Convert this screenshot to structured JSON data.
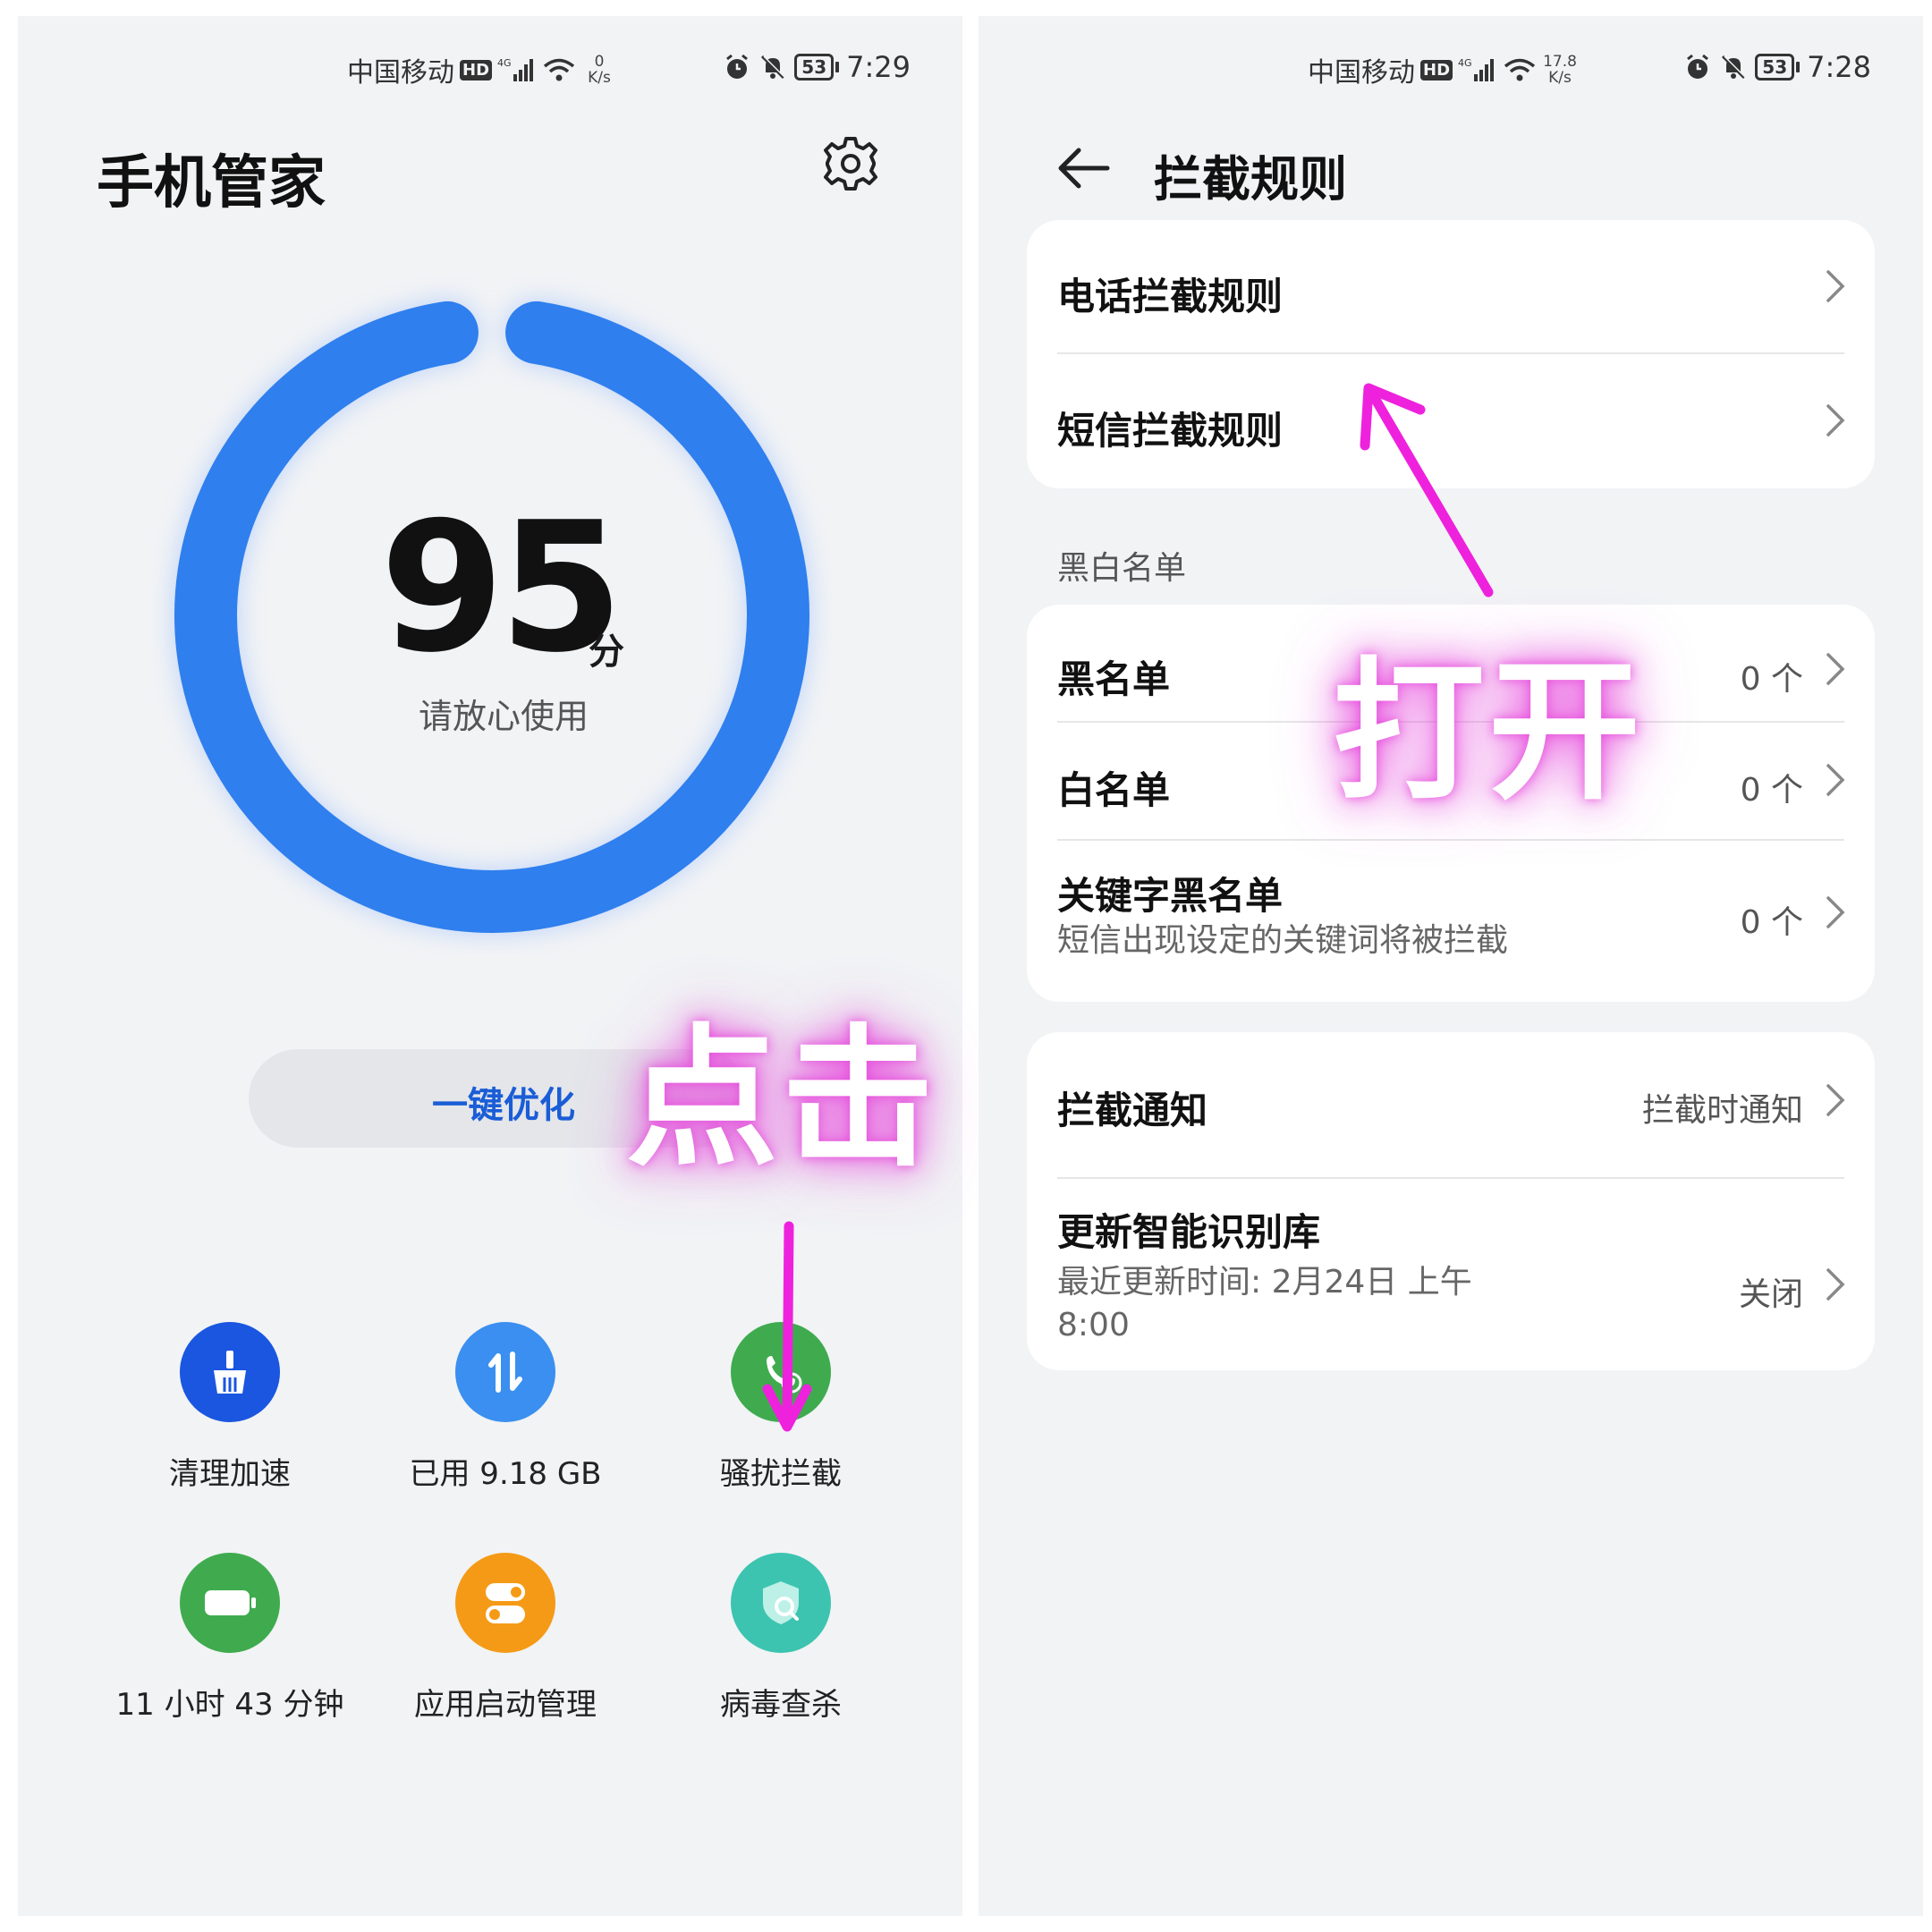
{
  "left": {
    "status": {
      "carrier": "中国移动",
      "hd": "HD",
      "network": "4G",
      "speed_value": "0",
      "speed_unit": "K/s",
      "battery": "53",
      "time": "7:29"
    },
    "title": "手机管家",
    "score": {
      "value": "95",
      "unit": "分",
      "subtitle": "请放心使用",
      "ring_fill_fraction": 0.95
    },
    "optimize_label": "一键优化",
    "tools": [
      {
        "label": "清理加速",
        "icon": "broom-icon",
        "color": "#1a56e0"
      },
      {
        "label": "已用 9.18 GB",
        "icon": "storage-arrows-icon",
        "color": "#3a8ff0"
      },
      {
        "label": "骚扰拦截",
        "icon": "block-call-icon",
        "color": "#3fab4e"
      },
      {
        "label": "11 小时 43 分钟",
        "icon": "battery-icon",
        "color": "#3fab4e"
      },
      {
        "label": "应用启动管理",
        "icon": "toggle-switch-icon",
        "color": "#f59a16"
      },
      {
        "label": "病毒查杀",
        "icon": "shield-search-icon",
        "color": "#3cc4b0"
      }
    ],
    "overlay": "点击"
  },
  "right": {
    "status": {
      "carrier": "中国移动",
      "hd": "HD",
      "network": "4G",
      "speed_value": "17.8",
      "speed_unit": "K/s",
      "battery": "53",
      "time": "7:28"
    },
    "title": "拦截规则",
    "rules": [
      {
        "title": "电话拦截规则"
      },
      {
        "title": "短信拦截规则"
      }
    ],
    "section_label": "黑白名单",
    "lists": [
      {
        "title": "黑名单",
        "value": "0 个"
      },
      {
        "title": "白名单",
        "value": "0 个"
      },
      {
        "title": "关键字黑名单",
        "subtitle": "短信出现设定的关键词将被拦截",
        "value": "0 个"
      }
    ],
    "notify": [
      {
        "title": "拦截通知",
        "value": "拦截时通知"
      },
      {
        "title": "更新智能识别库",
        "subtitle_line1": "最近更新时间: 2月24日 上午",
        "subtitle_line2": "8:00",
        "value": "关闭"
      }
    ],
    "overlay": "打开"
  },
  "colors": {
    "ring": "#2f7fee",
    "accent": "#1a5dd6",
    "annotation": "#ee22dd"
  }
}
